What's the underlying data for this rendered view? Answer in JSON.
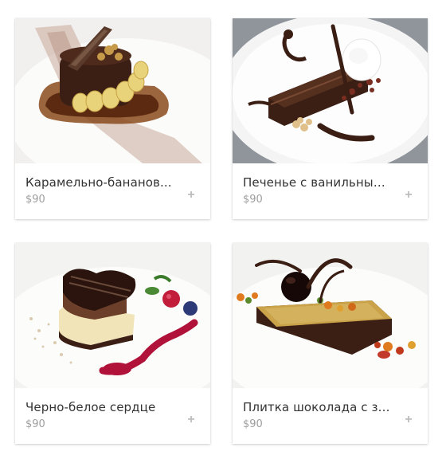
{
  "products": [
    {
      "title": "Карамельно-бананов...",
      "price": "$90",
      "add_label": "+",
      "image_icon": "caramel-banana-dessert-photo"
    },
    {
      "title": "Печенье с ванильным ...",
      "price": "$90",
      "add_label": "+",
      "image_icon": "chocolate-cookie-vanilla-dessert-photo"
    },
    {
      "title": "Черно-белое сердце",
      "price": "$90",
      "add_label": "+",
      "image_icon": "black-white-heart-dessert-photo"
    },
    {
      "title": "Плитка шоколада с зо...",
      "price": "$90",
      "add_label": "+",
      "image_icon": "chocolate-bar-dessert-photo"
    }
  ],
  "colors": {
    "title": "#333333",
    "price": "#9e9e9e",
    "add": "#bdbdbd",
    "chocolate": "#3b1f14",
    "caramel": "#b8742c"
  }
}
